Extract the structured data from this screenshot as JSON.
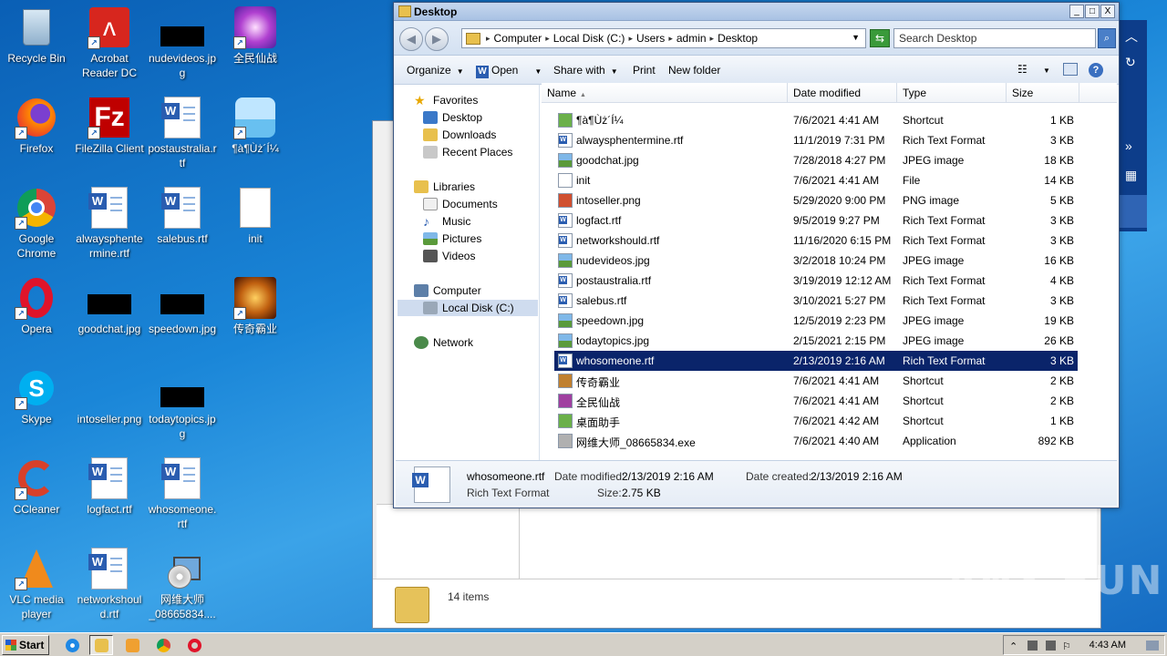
{
  "desktop": {
    "icons": [
      {
        "label": "Recycle Bin"
      },
      {
        "label": "Acrobat Reader DC"
      },
      {
        "label": "nudevideos.jpg"
      },
      {
        "label": "全民仙战"
      },
      {
        "label": "Firefox"
      },
      {
        "label": "FileZilla Client"
      },
      {
        "label": "postaustralia.rtf"
      },
      {
        "label": "¶à¶Ùż´Í¼"
      },
      {
        "label": "Google Chrome"
      },
      {
        "label": "alwaysphentermine.rtf"
      },
      {
        "label": "salebus.rtf"
      },
      {
        "label": "init"
      },
      {
        "label": "Opera"
      },
      {
        "label": "goodchat.jpg"
      },
      {
        "label": "speedown.jpg"
      },
      {
        "label": "传奇霸业"
      },
      {
        "label": "Skype"
      },
      {
        "label": "intoseller.png"
      },
      {
        "label": "todaytopics.jpg"
      },
      {
        "label": "CCleaner"
      },
      {
        "label": "logfact.rtf"
      },
      {
        "label": "whosomeone.rtf"
      },
      {
        "label": "VLC media player"
      },
      {
        "label": "networkshould.rtf"
      },
      {
        "label": "网维大师_08665834...."
      }
    ]
  },
  "window": {
    "title": "Desktop",
    "controls": {
      "minimize": "_",
      "maximize": "□",
      "close": "X"
    },
    "breadcrumb": [
      "Computer",
      "Local Disk (C:)",
      "Users",
      "admin",
      "Desktop"
    ],
    "search_placeholder": "Search Desktop",
    "toolbar": {
      "organize": "Organize",
      "open": "Open",
      "share_with": "Share with",
      "print": "Print",
      "new_folder": "New folder"
    },
    "nav": {
      "favorites": "Favorites",
      "desktop": "Desktop",
      "downloads": "Downloads",
      "recent_places": "Recent Places",
      "libraries": "Libraries",
      "documents": "Documents",
      "music": "Music",
      "pictures": "Pictures",
      "videos": "Videos",
      "computer": "Computer",
      "local_disk": "Local Disk (C:)",
      "network": "Network"
    },
    "columns": {
      "name": "Name",
      "date": "Date modified",
      "type": "Type",
      "size": "Size"
    },
    "files": [
      {
        "name": "¶à¶Ùż´Í¼",
        "date": "7/6/2021 4:41 AM",
        "type": "Shortcut",
        "size": "1 KB",
        "icon": "sc"
      },
      {
        "name": "alwaysphentermine.rtf",
        "date": "11/1/2019 7:31 PM",
        "type": "Rich Text Format",
        "size": "3 KB",
        "icon": "rtf"
      },
      {
        "name": "goodchat.jpg",
        "date": "7/28/2018 4:27 PM",
        "type": "JPEG image",
        "size": "18 KB",
        "icon": "img"
      },
      {
        "name": "init",
        "date": "7/6/2021 4:41 AM",
        "type": "File",
        "size": "14 KB",
        "icon": "file"
      },
      {
        "name": "intoseller.png",
        "date": "5/29/2020 9:00 PM",
        "type": "PNG image",
        "size": "5 KB",
        "icon": "png"
      },
      {
        "name": "logfact.rtf",
        "date": "9/5/2019 9:27 PM",
        "type": "Rich Text Format",
        "size": "3 KB",
        "icon": "rtf"
      },
      {
        "name": "networkshould.rtf",
        "date": "11/16/2020 6:15 PM",
        "type": "Rich Text Format",
        "size": "3 KB",
        "icon": "rtf"
      },
      {
        "name": "nudevideos.jpg",
        "date": "3/2/2018 10:24 PM",
        "type": "JPEG image",
        "size": "16 KB",
        "icon": "img"
      },
      {
        "name": "postaustralia.rtf",
        "date": "3/19/2019 12:12 AM",
        "type": "Rich Text Format",
        "size": "4 KB",
        "icon": "rtf"
      },
      {
        "name": "salebus.rtf",
        "date": "3/10/2021 5:27 PM",
        "type": "Rich Text Format",
        "size": "3 KB",
        "icon": "rtf"
      },
      {
        "name": "speedown.jpg",
        "date": "12/5/2019 2:23 PM",
        "type": "JPEG image",
        "size": "19 KB",
        "icon": "img"
      },
      {
        "name": "todaytopics.jpg",
        "date": "2/15/2021 2:15 PM",
        "type": "JPEG image",
        "size": "26 KB",
        "icon": "img"
      },
      {
        "name": "whosomeone.rtf",
        "date": "2/13/2019 2:16 AM",
        "type": "Rich Text Format",
        "size": "3 KB",
        "icon": "rtf",
        "selected": true
      },
      {
        "name": "传奇霸业",
        "date": "7/6/2021 4:41 AM",
        "type": "Shortcut",
        "size": "2 KB",
        "icon": "game1"
      },
      {
        "name": "全民仙战",
        "date": "7/6/2021 4:41 AM",
        "type": "Shortcut",
        "size": "2 KB",
        "icon": "game2"
      },
      {
        "name": "桌面助手",
        "date": "7/6/2021 4:42 AM",
        "type": "Shortcut",
        "size": "1 KB",
        "icon": "sc"
      },
      {
        "name": "网维大师_08665834.exe",
        "date": "7/6/2021 4:40 AM",
        "type": "Application",
        "size": "892 KB",
        "icon": "app"
      }
    ],
    "details": {
      "name": "whosomeone.rtf",
      "type": "Rich Text Format",
      "modified_label": "Date modified:",
      "modified": "2/13/2019 2:16 AM",
      "created_label": "Date created:",
      "created": "2/13/2019 2:16 AM",
      "size_label": "Size:",
      "size": "2.75 KB"
    }
  },
  "background_window": {
    "status": "14 items"
  },
  "taskbar": {
    "start": "Start",
    "clock": "4:43 AM"
  },
  "watermark": "ANY RUN"
}
